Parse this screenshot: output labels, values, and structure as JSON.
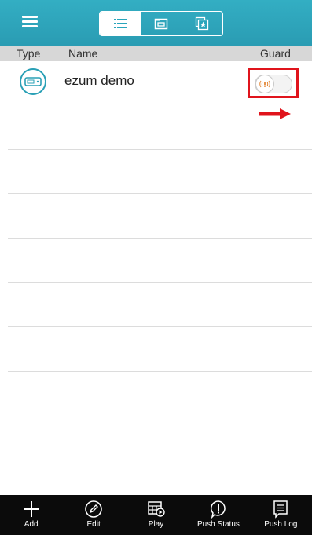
{
  "header": {
    "tabs": [
      {
        "icon": "list-icon",
        "active": true
      },
      {
        "icon": "folder-icon",
        "active": false
      },
      {
        "icon": "star-icon",
        "active": false
      }
    ],
    "accent": "#2aa5bb"
  },
  "columns": {
    "type": "Type",
    "name": "Name",
    "guard": "Guard"
  },
  "devices": [
    {
      "name": "ezum demo",
      "type_icon": "dvr-icon",
      "guard_on": false
    }
  ],
  "highlight_color": "#e0141c",
  "toolbar": {
    "add": "Add",
    "edit": "Edit",
    "play": "Play",
    "push_status": "Push Status",
    "push_log": "Push Log"
  }
}
